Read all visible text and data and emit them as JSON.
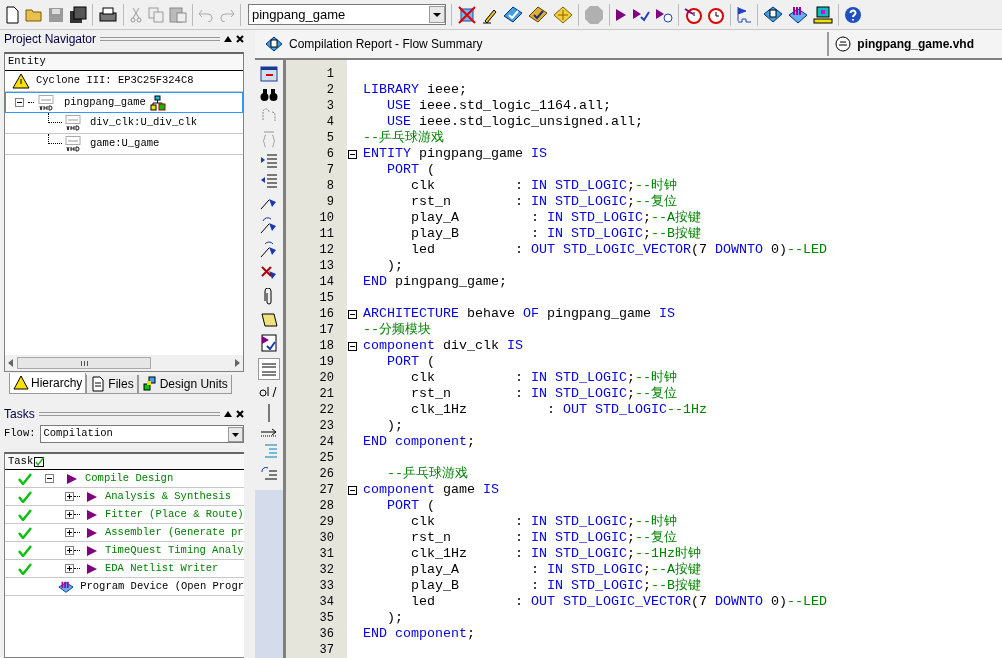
{
  "toolbar": {
    "project": "pingpang_game"
  },
  "navigator": {
    "title": "Project Navigator",
    "column": "Entity",
    "device": "Cyclone III: EP3C25F324C8",
    "entities": [
      {
        "label": "pingpang_game",
        "selected": true,
        "expanded": true,
        "children": [
          {
            "label": "div_clk:U_div_clk",
            "selected": false
          },
          {
            "label": "game:U_game",
            "selected": false
          }
        ]
      }
    ],
    "tabs": [
      {
        "label": "Hierarchy",
        "selected": true
      },
      {
        "label": "Files",
        "selected": false
      },
      {
        "label": "Design Units",
        "selected": false
      }
    ]
  },
  "tasks": {
    "title": "Tasks",
    "flow_label": "Flow:",
    "flow": "Compilation",
    "column": "Task",
    "items": [
      {
        "label": "Compile Design",
        "done": true,
        "expanded": true,
        "kind": "flow",
        "children": [
          {
            "label": "Analysis & Synthesis",
            "done": true,
            "expanded": false,
            "kind": "flow"
          },
          {
            "label": "Fitter (Place & Route)",
            "done": true,
            "expanded": false,
            "kind": "flow"
          },
          {
            "label": "Assembler (Generate pr",
            "done": true,
            "expanded": false,
            "kind": "flow"
          },
          {
            "label": "TimeQuest Timing Analy",
            "done": true,
            "expanded": false,
            "kind": "flow"
          },
          {
            "label": "EDA Netlist Writer",
            "done": true,
            "expanded": false,
            "kind": "flow"
          }
        ]
      },
      {
        "label": "Program Device (Open Progr",
        "done": false,
        "kind": "tool"
      }
    ]
  },
  "editor": {
    "tabs": [
      {
        "label": "Compilation Report - Flow Summary",
        "selected": false,
        "kind": "report"
      },
      {
        "label": "pingpang_game.vhd",
        "selected": true,
        "kind": "file"
      }
    ],
    "lines": [
      {
        "n": "1",
        "fold": false
      },
      {
        "n": "2",
        "fold": false,
        "segs": [
          {
            "kind": "keyword",
            "text": "LIBRARY"
          },
          {
            "kind": "plain",
            "text": " ieee;"
          }
        ]
      },
      {
        "n": "3",
        "fold": false,
        "segs": [
          {
            "kind": "keyword",
            "text": "   USE"
          },
          {
            "kind": "plain",
            "text": " ieee.std_logic_1164.all;"
          }
        ]
      },
      {
        "n": "4",
        "fold": false,
        "segs": [
          {
            "kind": "keyword",
            "text": "   USE"
          },
          {
            "kind": "plain",
            "text": " ieee.std_logic_unsigned.all;"
          }
        ]
      },
      {
        "n": "5",
        "fold": false,
        "segs": [
          {
            "kind": "comment",
            "text": "--乒乓球游戏"
          }
        ]
      },
      {
        "n": "6",
        "fold": true,
        "segs": [
          {
            "kind": "keyword",
            "text": "ENTITY"
          },
          {
            "kind": "plain",
            "text": " pingpang_game "
          },
          {
            "kind": "keyword",
            "text": "IS"
          }
        ]
      },
      {
        "n": "7",
        "fold": false,
        "segs": [
          {
            "kind": "keyword",
            "text": "   PORT"
          },
          {
            "kind": "plain",
            "text": " ("
          }
        ]
      },
      {
        "n": "8",
        "fold": false,
        "segs": [
          {
            "kind": "plain",
            "text": "      clk          : "
          },
          {
            "kind": "keyword",
            "text": "IN STD_LOGIC"
          },
          {
            "kind": "plain",
            "text": ";"
          },
          {
            "kind": "comment",
            "text": "--时钟"
          }
        ]
      },
      {
        "n": "9",
        "fold": false,
        "segs": [
          {
            "kind": "plain",
            "text": "      rst_n        : "
          },
          {
            "kind": "keyword",
            "text": "IN STD_LOGIC"
          },
          {
            "kind": "plain",
            "text": ";"
          },
          {
            "kind": "comment",
            "text": "--复位"
          }
        ]
      },
      {
        "n": "10",
        "fold": false,
        "segs": [
          {
            "kind": "plain",
            "text": "      play_A         : "
          },
          {
            "kind": "keyword",
            "text": "IN STD_LOGIC"
          },
          {
            "kind": "plain",
            "text": ";"
          },
          {
            "kind": "comment",
            "text": "--A按键"
          }
        ]
      },
      {
        "n": "11",
        "fold": false,
        "segs": [
          {
            "kind": "plain",
            "text": "      play_B         : "
          },
          {
            "kind": "keyword",
            "text": "IN STD_LOGIC"
          },
          {
            "kind": "plain",
            "text": ";"
          },
          {
            "kind": "comment",
            "text": "--B按键"
          }
        ]
      },
      {
        "n": "12",
        "fold": false,
        "segs": [
          {
            "kind": "plain",
            "text": "      led          : "
          },
          {
            "kind": "keyword",
            "text": "OUT STD_LOGIC_VECTOR"
          },
          {
            "kind": "plain",
            "text": "(7 "
          },
          {
            "kind": "keyword",
            "text": "DOWNTO"
          },
          {
            "kind": "plain",
            "text": " 0)"
          },
          {
            "kind": "comment",
            "text": "--LED"
          }
        ]
      },
      {
        "n": "13",
        "fold": false,
        "segs": [
          {
            "kind": "plain",
            "text": "   );"
          }
        ]
      },
      {
        "n": "14",
        "fold": false,
        "segs": [
          {
            "kind": "keyword",
            "text": "END"
          },
          {
            "kind": "plain",
            "text": " pingpang_game;"
          }
        ]
      },
      {
        "n": "15",
        "fold": false
      },
      {
        "n": "16",
        "fold": true,
        "segs": [
          {
            "kind": "keyword",
            "text": "ARCHITECTURE"
          },
          {
            "kind": "plain",
            "text": " behave "
          },
          {
            "kind": "keyword",
            "text": "OF"
          },
          {
            "kind": "plain",
            "text": " pingpang_game "
          },
          {
            "kind": "keyword",
            "text": "IS"
          }
        ]
      },
      {
        "n": "17",
        "fold": false,
        "segs": [
          {
            "kind": "comment",
            "text": "--分频模块"
          }
        ]
      },
      {
        "n": "18",
        "fold": true,
        "segs": [
          {
            "kind": "keyword",
            "text": "component"
          },
          {
            "kind": "plain",
            "text": " div_clk "
          },
          {
            "kind": "keyword",
            "text": "IS"
          }
        ]
      },
      {
        "n": "19",
        "fold": false,
        "segs": [
          {
            "kind": "keyword",
            "text": "   PORT"
          },
          {
            "kind": "plain",
            "text": " ("
          }
        ]
      },
      {
        "n": "20",
        "fold": false,
        "segs": [
          {
            "kind": "plain",
            "text": "      clk          : "
          },
          {
            "kind": "keyword",
            "text": "IN STD_LOGIC"
          },
          {
            "kind": "plain",
            "text": ";"
          },
          {
            "kind": "comment",
            "text": "--时钟"
          }
        ]
      },
      {
        "n": "21",
        "fold": false,
        "segs": [
          {
            "kind": "plain",
            "text": "      rst_n        : "
          },
          {
            "kind": "keyword",
            "text": "IN STD_LOGIC"
          },
          {
            "kind": "plain",
            "text": ";"
          },
          {
            "kind": "comment",
            "text": "--复位"
          }
        ]
      },
      {
        "n": "22",
        "fold": false,
        "segs": [
          {
            "kind": "plain",
            "text": "      clk_1Hz          : "
          },
          {
            "kind": "keyword",
            "text": "OUT STD_LOGIC"
          },
          {
            "kind": "comment",
            "text": "--1Hz"
          }
        ]
      },
      {
        "n": "23",
        "fold": false,
        "segs": [
          {
            "kind": "plain",
            "text": "   );"
          }
        ]
      },
      {
        "n": "24",
        "fold": false,
        "segs": [
          {
            "kind": "keyword",
            "text": "END component"
          },
          {
            "kind": "plain",
            "text": ";"
          }
        ]
      },
      {
        "n": "25",
        "fold": false
      },
      {
        "n": "26",
        "fold": false,
        "segs": [
          {
            "kind": "comment",
            "text": "   --乒乓球游戏"
          }
        ]
      },
      {
        "n": "27",
        "fold": true,
        "segs": [
          {
            "kind": "keyword",
            "text": "component"
          },
          {
            "kind": "plain",
            "text": " game "
          },
          {
            "kind": "keyword",
            "text": "IS"
          }
        ]
      },
      {
        "n": "28",
        "fold": false,
        "segs": [
          {
            "kind": "keyword",
            "text": "   PORT"
          },
          {
            "kind": "plain",
            "text": " ("
          }
        ]
      },
      {
        "n": "29",
        "fold": false,
        "segs": [
          {
            "kind": "plain",
            "text": "      clk          : "
          },
          {
            "kind": "keyword",
            "text": "IN STD_LOGIC"
          },
          {
            "kind": "plain",
            "text": ";"
          },
          {
            "kind": "comment",
            "text": "--时钟"
          }
        ]
      },
      {
        "n": "30",
        "fold": false,
        "segs": [
          {
            "kind": "plain",
            "text": "      rst_n        : "
          },
          {
            "kind": "keyword",
            "text": "IN STD_LOGIC"
          },
          {
            "kind": "plain",
            "text": ";"
          },
          {
            "kind": "comment",
            "text": "--复位"
          }
        ]
      },
      {
        "n": "31",
        "fold": false,
        "segs": [
          {
            "kind": "plain",
            "text": "      clk_1Hz      : "
          },
          {
            "kind": "keyword",
            "text": "IN STD_LOGIC"
          },
          {
            "kind": "plain",
            "text": ";"
          },
          {
            "kind": "comment",
            "text": "--1Hz时钟"
          }
        ]
      },
      {
        "n": "32",
        "fold": false,
        "segs": [
          {
            "kind": "plain",
            "text": "      play_A         : "
          },
          {
            "kind": "keyword",
            "text": "IN STD_LOGIC"
          },
          {
            "kind": "plain",
            "text": ";"
          },
          {
            "kind": "comment",
            "text": "--A按键"
          }
        ]
      },
      {
        "n": "33",
        "fold": false,
        "segs": [
          {
            "kind": "plain",
            "text": "      play_B         : "
          },
          {
            "kind": "keyword",
            "text": "IN STD_LOGIC"
          },
          {
            "kind": "plain",
            "text": ";"
          },
          {
            "kind": "comment",
            "text": "--B按键"
          }
        ]
      },
      {
        "n": "34",
        "fold": false,
        "segs": [
          {
            "kind": "plain",
            "text": "      led          : "
          },
          {
            "kind": "keyword",
            "text": "OUT STD_LOGIC_VECTOR"
          },
          {
            "kind": "plain",
            "text": "(7 "
          },
          {
            "kind": "keyword",
            "text": "DOWNTO"
          },
          {
            "kind": "plain",
            "text": " 0)"
          },
          {
            "kind": "comment",
            "text": "--LED"
          }
        ]
      },
      {
        "n": "35",
        "fold": false,
        "segs": [
          {
            "kind": "plain",
            "text": "   );"
          }
        ]
      },
      {
        "n": "36",
        "fold": false,
        "segs": [
          {
            "kind": "keyword",
            "text": "END component"
          },
          {
            "kind": "plain",
            "text": ";"
          }
        ]
      },
      {
        "n": "37",
        "fold": false
      }
    ]
  }
}
